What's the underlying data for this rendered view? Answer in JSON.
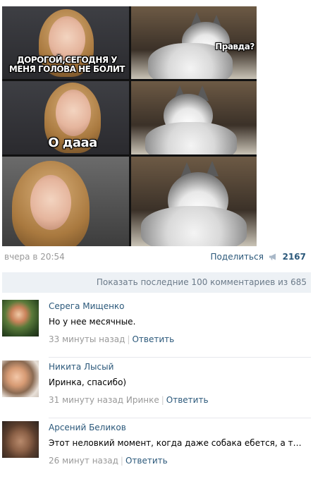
{
  "meme": {
    "caption_top": "ДОРОГОЙ,СЕГОДНЯ У МЕНЯ ГОЛОВА НЕ БОЛИТ",
    "caption_dog": "Правда?",
    "caption_mid": "О дааа"
  },
  "post": {
    "date": "вчера в 20:54",
    "share_label": "Поделиться",
    "share_count": "2167"
  },
  "comments_header": {
    "show_more": "Показать последние 100 комментариев из 685"
  },
  "comments": [
    {
      "author": "Серега Мищенко",
      "text": "Но у нее месячные.",
      "time": "33 минуты назад",
      "reply_to": "",
      "reply_label": "Ответить"
    },
    {
      "author": "Никита Лысый",
      "text": "Иринка, спасибо)",
      "time": "31 минуту назад",
      "reply_to": "Иринке",
      "reply_label": "Ответить"
    },
    {
      "author": "Арсений Беликов",
      "text": "Этот неловкий момент, когда даже собака ебется, а ты нет...",
      "time": "26 минут назад",
      "reply_to": "",
      "reply_label": "Ответить"
    }
  ],
  "colors": {
    "link": "#2b587a",
    "muted": "#999999",
    "show_more_bg": "#edf1f5"
  }
}
